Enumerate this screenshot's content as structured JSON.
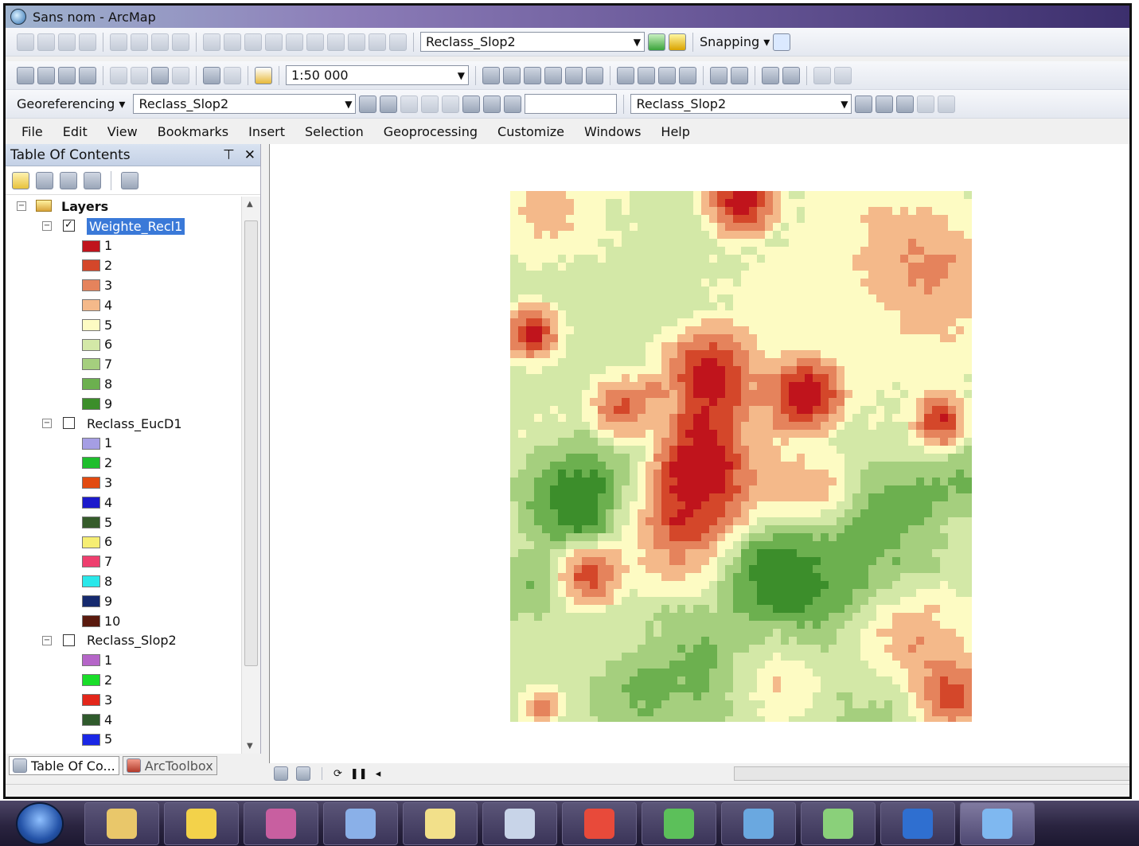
{
  "window": {
    "title": "Sans nom - ArcMap"
  },
  "toolbar1": {
    "layer_combo": "Reclass_Slop2",
    "snapping_label": "Snapping",
    "icons": [
      "editor-tool-icon",
      "sketch-tool-icon",
      "align-left-icon",
      "align-center-icon",
      "align-right-icon",
      "distribute-icon",
      "order-icon",
      "group-icon",
      "rotate-icon",
      "flip-icon",
      "layer-icon",
      "histogram-icon",
      "overflow-icon",
      "snap-circle-icon"
    ]
  },
  "toolbar2": {
    "scale_value": "1:50 000",
    "icons": [
      "new-icon",
      "open-icon",
      "save-icon",
      "print-icon",
      "cut-icon",
      "copy-icon",
      "paste-icon",
      "delete-icon",
      "undo-icon",
      "redo-icon",
      "add-data-icon",
      "editor-icon",
      "table-icon",
      "catalog-icon",
      "search-window-icon",
      "python-icon",
      "model-icon",
      "zoom-in-icon",
      "zoom-out-icon",
      "pan-icon",
      "full-extent-icon",
      "fixed-zoom-in-icon",
      "fixed-zoom-out-icon",
      "back-icon",
      "forward-icon",
      "select-icon",
      "identify-icon"
    ]
  },
  "toolbar3": {
    "georeferencing_label": "Georeferencing",
    "georef_layer_combo": "Reclass_Slop2",
    "effects_layer_combo": "Reclass_Slop2",
    "icons": [
      "add-control-points-icon",
      "auto-registration-icon",
      "select-link-icon",
      "zoom-to-selected-link-icon",
      "delete-link-icon",
      "view-link-table-icon",
      "viewer-icon",
      "rotate-icon",
      "contrast-icon",
      "brightness-icon",
      "transparency-icon",
      "swipe-icon",
      "flicker-icon"
    ]
  },
  "menu": [
    "File",
    "Edit",
    "View",
    "Bookmarks",
    "Insert",
    "Selection",
    "Geoprocessing",
    "Customize",
    "Windows",
    "Help"
  ],
  "toc": {
    "title": "Table Of Contents",
    "root_label": "Layers",
    "layers": [
      {
        "name": "Weighte_Recl1",
        "checked": true,
        "selected": true,
        "classes": [
          {
            "label": "1",
            "color": "#c0141c"
          },
          {
            "label": "2",
            "color": "#d4472a"
          },
          {
            "label": "3",
            "color": "#e5835c"
          },
          {
            "label": "4",
            "color": "#f4b98a"
          },
          {
            "label": "5",
            "color": "#fdfbc3"
          },
          {
            "label": "6",
            "color": "#d3e8a7"
          },
          {
            "label": "7",
            "color": "#a5cf7e"
          },
          {
            "label": "8",
            "color": "#6cb04f"
          },
          {
            "label": "9",
            "color": "#3c8e2b"
          }
        ]
      },
      {
        "name": "Reclass_EucD1",
        "checked": false,
        "selected": false,
        "classes": [
          {
            "label": "1",
            "color": "#a59ee4"
          },
          {
            "label": "2",
            "color": "#1ebe2c"
          },
          {
            "label": "3",
            "color": "#e24a10"
          },
          {
            "label": "4",
            "color": "#1c1acc"
          },
          {
            "label": "5",
            "color": "#355b2a"
          },
          {
            "label": "6",
            "color": "#f6ee73"
          },
          {
            "label": "7",
            "color": "#ee3f6e"
          },
          {
            "label": "8",
            "color": "#2ae8ea"
          },
          {
            "label": "9",
            "color": "#162a6e"
          },
          {
            "label": "10",
            "color": "#5a1a0e"
          }
        ]
      },
      {
        "name": "Reclass_Slop2",
        "checked": false,
        "selected": false,
        "classes": [
          {
            "label": "1",
            "color": "#b565c8"
          },
          {
            "label": "2",
            "color": "#19de29"
          },
          {
            "label": "3",
            "color": "#e3261a"
          },
          {
            "label": "4",
            "color": "#2f5a2c"
          },
          {
            "label": "5",
            "color": "#1a27e6"
          }
        ]
      }
    ]
  },
  "bottom_tabs": [
    "Table Of Co...",
    "ArcToolbox"
  ],
  "taskbar": {
    "apps": [
      "explorer",
      "solitaire",
      "winrar",
      "paint",
      "notes",
      "calculator",
      "acrobat",
      "picasa",
      "photo-viewer",
      "movie-maker",
      "word",
      "arcmap"
    ]
  }
}
